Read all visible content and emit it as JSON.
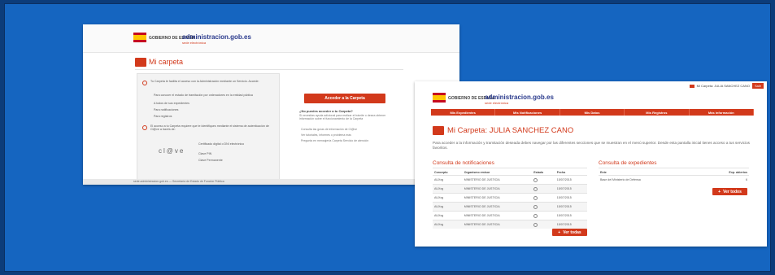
{
  "left_screenshot": {
    "header": {
      "gov_label": "GOBIERNO DE ESPAÑA",
      "sede_name": "administracion.gob.es",
      "sede_sub": "sede electrónica"
    },
    "page_title": "Mi carpeta",
    "panel_text_1": "Tu Carpeta te facilita el acceso con la Administración mediante un Servicio. Accede:",
    "panel_items": [
      "Para conocer el estado de tramitación por ordenadores en la entidad pública",
      "A todos de sus expedientes",
      "Para notificaciones",
      "Para registros"
    ],
    "panel_text_2": "El acceso a tu Carpeta requiere que te identifiques mediante el sistema de autenticación de Cl@ve a través de:",
    "clave_logo": "cl@ve",
    "clave_options": [
      "Certificado digital o DNI electrónico",
      "Clave PIN",
      "Clave Permanente"
    ],
    "access_button": "Acceder a la Carpeta",
    "side_question": "¿No puedes acceder a tu Carpeta?",
    "side_text": "Si necesitas ayuda adicional para realizar el trámite o desea obtener información sobre el funcionamiento de la Carpeta",
    "side_links": [
      "Consulta las guías de información de Cl@ve",
      "Ver tutoriales, informes o problema más",
      "Pregunta en mensajería Carpeta Servicio de atención"
    ],
    "footer_text": "sede.administracion.gob.es — Secretaría de Estado de Función Pública"
  },
  "right_screenshot": {
    "header": {
      "gov_label": "GOBIERNO DE ESPAÑA",
      "sede_name": "administracion.gob.es",
      "sede_sub": "sede electrónica"
    },
    "user_label": "Mi Carpeta: JULIA SANCHEZ CANO",
    "exit_button": "Salir",
    "nav_items": [
      "Mis Expedientes",
      "Mis Notificaciones",
      "Mis Datos",
      "Mis Registros",
      "Más información"
    ],
    "page_title": "Mi Carpeta: JULIA SANCHEZ CANO",
    "intro": "Para acceder a la información y tramitación deseada debes navegar por las diferentes secciones que se muestran en el menú superior. Desde esta pantalla inicial tienes acceso a tus servicios favoritos.",
    "notifications": {
      "title": "Consulta de notificaciones",
      "columns": [
        "Concepto",
        "Organismo emisor",
        "Estado",
        "Fecha"
      ],
      "rows": [
        [
          "AUXxg",
          "MINISTERIO DE JUSTICIA",
          "",
          "15/07/2015"
        ],
        [
          "AUXxg",
          "MINISTERIO DE JUSTICIA",
          "",
          "15/07/2015"
        ],
        [
          "AUXxg",
          "MINISTERIO DE JUSTICIA",
          "",
          "15/07/2015"
        ],
        [
          "AUXxg",
          "MINISTERIO DE JUSTICIA",
          "",
          "15/07/2015"
        ],
        [
          "AUXxg",
          "MINISTERIO DE JUSTICIA",
          "",
          "15/07/2015"
        ],
        [
          "AUXxg",
          "MINISTERIO DE JUSTICIA",
          "",
          "15/07/2015"
        ]
      ],
      "more_button": "Ver todas"
    },
    "expedientes": {
      "title": "Consulta de expedientes",
      "columns": [
        "Ente",
        "Exp. abiertos"
      ],
      "rows": [
        [
          "Base del Ministerio de Defensa",
          "6"
        ]
      ],
      "more_button": "Ver todos"
    }
  }
}
